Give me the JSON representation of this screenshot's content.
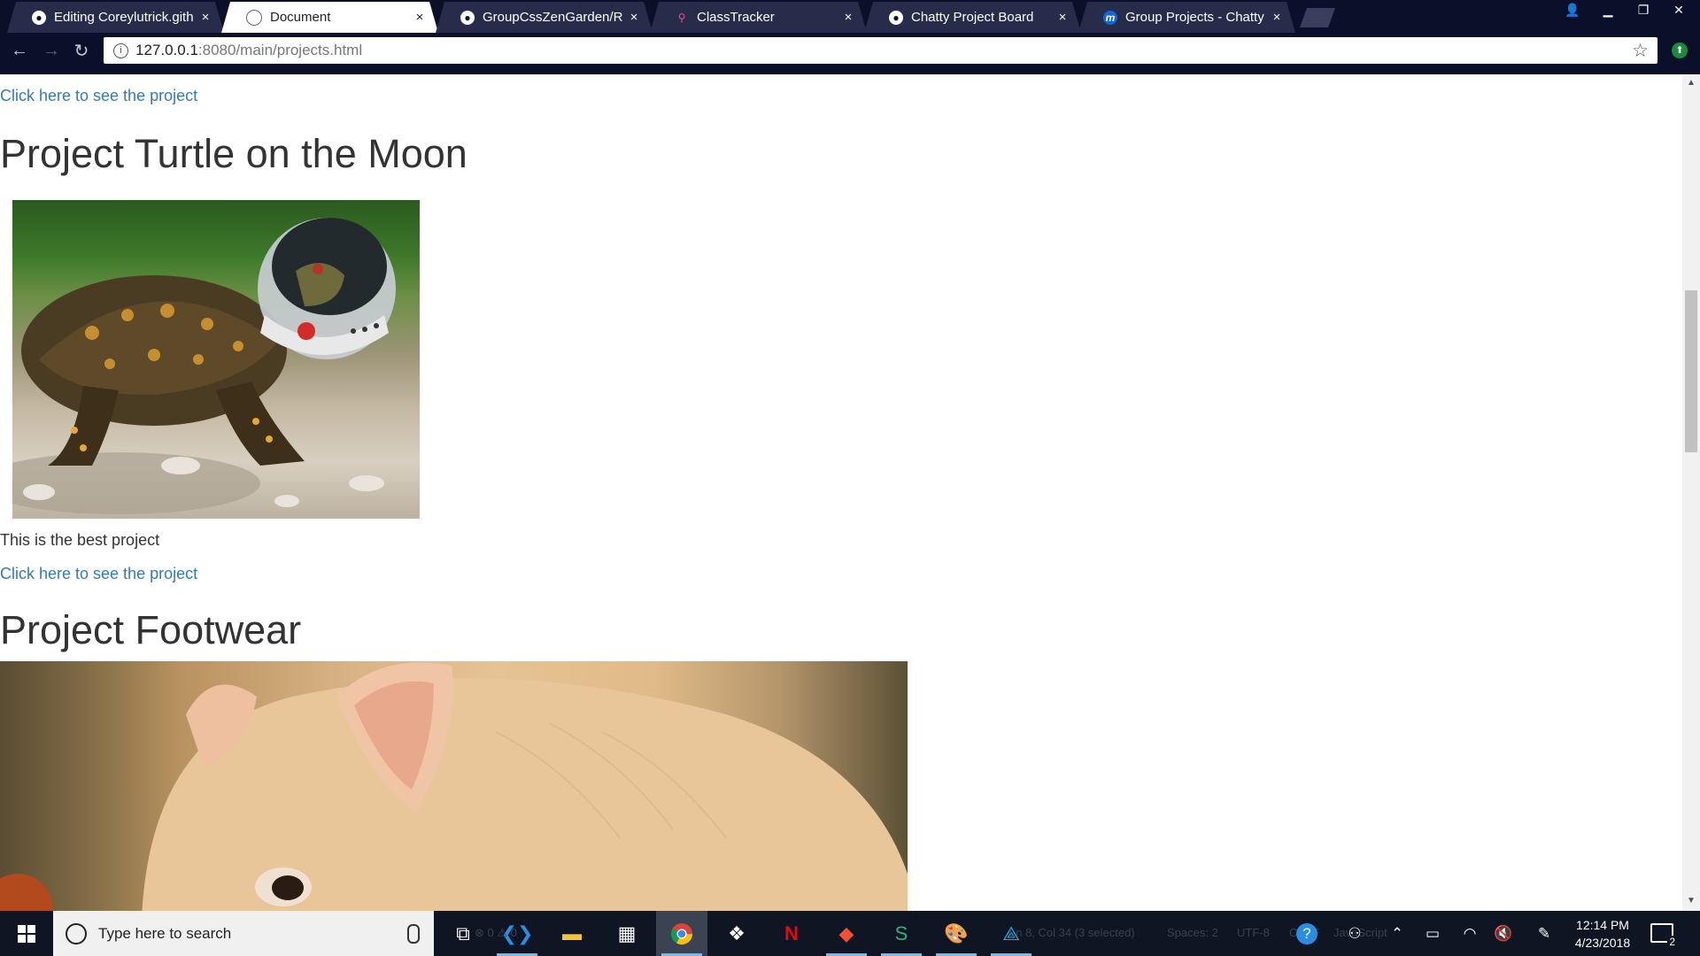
{
  "browser": {
    "tabs": [
      {
        "title": "Editing Coreylutrick.githu",
        "icon": "github-icon",
        "active": false
      },
      {
        "title": "Document",
        "icon": "document-icon",
        "active": true
      },
      {
        "title": "GroupCssZenGarden/RE/",
        "icon": "github-icon",
        "active": false
      },
      {
        "title": "ClassTracker",
        "icon": "flamingo-icon",
        "active": false
      },
      {
        "title": "Chatty Project Board",
        "icon": "github-icon",
        "active": false
      },
      {
        "title": "Group Projects - Chatty -",
        "icon": "m-icon",
        "active": false
      }
    ],
    "close_glyph": "×",
    "url_host": "127.0.0.1",
    "url_rest": ":8080/main/projects.html",
    "info_glyph": "i",
    "star_glyph": "☆"
  },
  "page": {
    "top_link": "Click here to see the project",
    "projects": [
      {
        "title": "Project Turtle on the Moon",
        "description": "This is the best project",
        "link": "Click here to see the project"
      },
      {
        "title": "Project Footwear"
      }
    ]
  },
  "taskbar": {
    "search_placeholder": "Type here to search",
    "time": "12:14 PM",
    "date": "4/23/2018",
    "notification_count": "2",
    "status_ghost": {
      "position": "Ln 8, Col 34 (3 selected)",
      "spaces": "Spaces: 2",
      "encoding": "UTF-8",
      "eol": "CRLF",
      "language": "JavaScript",
      "problems": "⊗ 0 ⚠ 0"
    }
  },
  "colors": {
    "chrome_dark": "#0a0f2a",
    "link": "#337ab7",
    "taskbar": "#0f1522"
  }
}
